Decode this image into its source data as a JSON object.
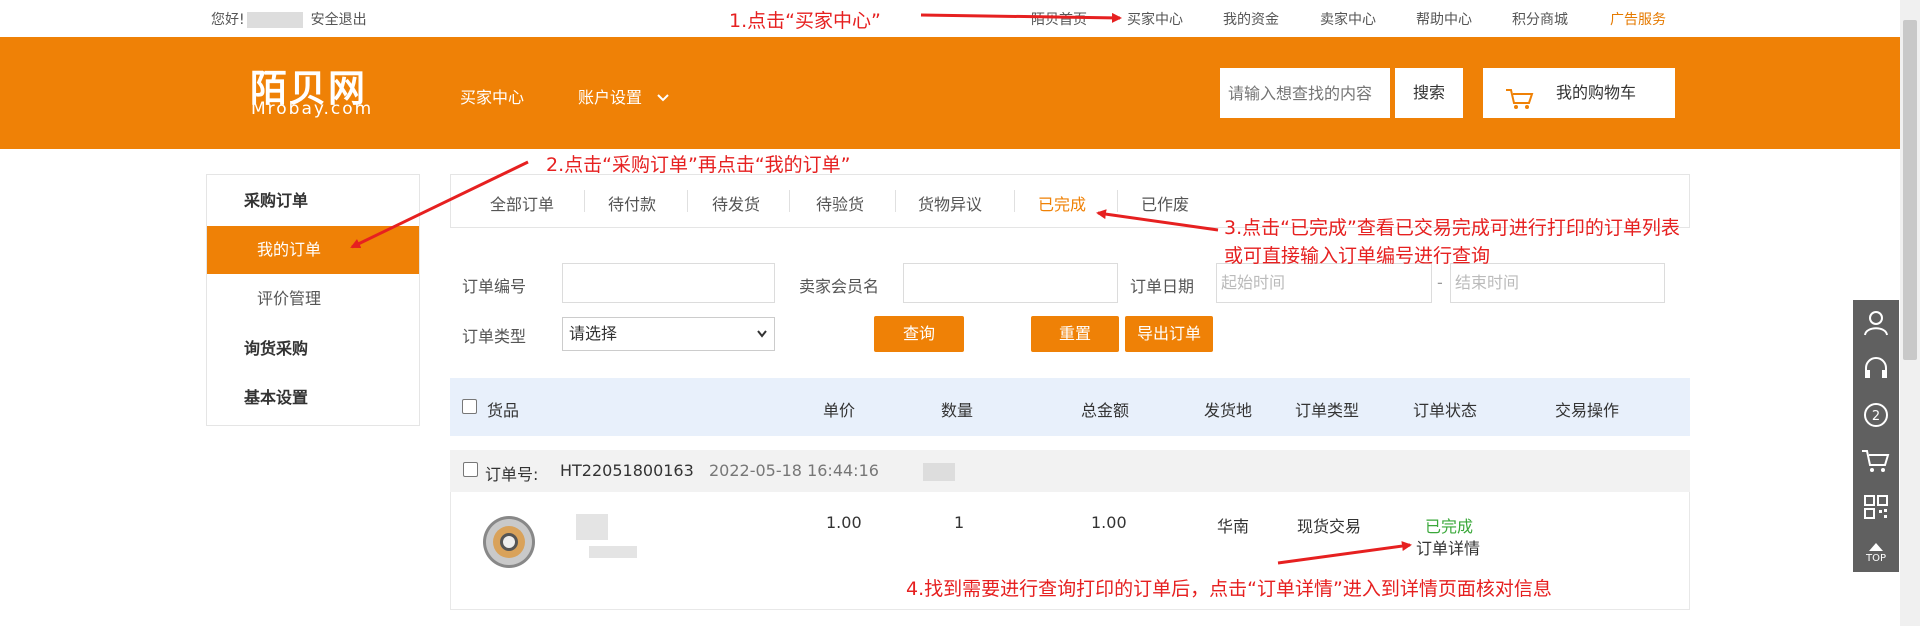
{
  "topbar": {
    "greeting": "您好!",
    "logout": "安全退出",
    "links": [
      "陌贝首页",
      "买家中心",
      "我的资金",
      "卖家中心",
      "帮助中心",
      "积分商城",
      "广告服务"
    ]
  },
  "header": {
    "logo_cn": "陌贝网",
    "logo_en": "Mrobay.com",
    "nav": [
      "买家中心",
      "账户设置"
    ],
    "search_placeholder": "请输入想查找的内容",
    "search_button": "搜索",
    "cart_label": "我的购物车"
  },
  "sidebar": {
    "group1": "采购订单",
    "my_orders": "我的订单",
    "reviews": "评价管理",
    "group2": "询货采购",
    "group3": "基本设置"
  },
  "tabs": [
    "全部订单",
    "待付款",
    "待发货",
    "待验货",
    "货物异议",
    "已完成",
    "已作废"
  ],
  "active_tab": "已完成",
  "filters": {
    "order_no_label": "订单编号",
    "seller_label": "卖家会员名",
    "date_label": "订单日期",
    "start_placeholder": "起始时间",
    "end_placeholder": "结束时间",
    "date_sep": "-",
    "type_label": "订单类型",
    "type_selected": "请选择",
    "query": "查询",
    "reset": "重置",
    "export": "导出订单"
  },
  "table_header": [
    "货品",
    "单价",
    "数量",
    "总金额",
    "发货地",
    "订单类型",
    "订单状态",
    "交易操作"
  ],
  "order": {
    "no_label": "订单号:",
    "no": "HT22051800163",
    "time": "2022-05-18 16:44:16",
    "price": "1.00",
    "qty": "1",
    "total": "1.00",
    "origin": "华南",
    "type": "现货交易",
    "status": "已完成",
    "detail": "订单详情"
  },
  "annotations": {
    "step1": "1.点击“买家中心”",
    "step2": "2.点击“采购订单”再点击“我的订单”",
    "step3_line1": "3.点击“已完成”查看已交易完成可进行打印的订单列表",
    "step3_line2": "或可直接输入订单编号进行查询",
    "step4": "4.找到需要进行查询打印的订单后，点击“订单详情”进入到详情页面核对信息"
  },
  "float_top": "TOP",
  "colors": {
    "brand": "#ef8106",
    "annotation": "#e62020",
    "status_done": "#3aa83a"
  }
}
